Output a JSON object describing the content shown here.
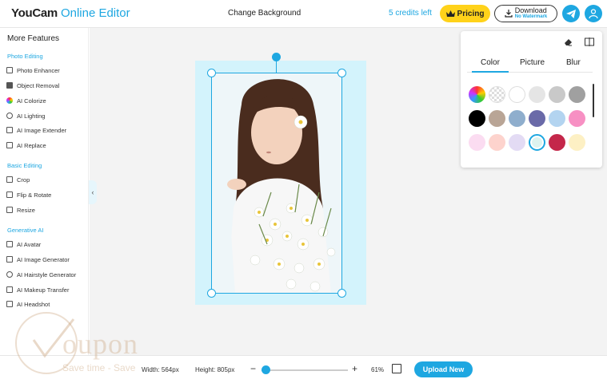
{
  "header": {
    "logo_brand": "YouCam",
    "logo_sub": "Online Editor",
    "page_title": "Change Background",
    "credits": "5 credits left",
    "pricing_label": "Pricing",
    "download_label": "Download",
    "download_sub": "No Watermark"
  },
  "sidebar": {
    "heading": "More Features",
    "sections": [
      {
        "title": "Photo Editing",
        "items": [
          "Photo Enhancer",
          "Object Removal",
          "AI Colorize",
          "AI Lighting",
          "AI Image Extender",
          "AI Replace"
        ]
      },
      {
        "title": "Basic Editing",
        "items": [
          "Crop",
          "Flip & Rotate",
          "Resize"
        ]
      },
      {
        "title": "Generative AI",
        "items": [
          "AI Avatar",
          "AI Image Generator",
          "AI Hairstyle Generator",
          "AI Makeup Transfer",
          "AI Headshot"
        ]
      }
    ]
  },
  "panel": {
    "tabs": [
      "Color",
      "Picture",
      "Blur"
    ],
    "active_tab": "Color",
    "swatches": [
      [
        "picker",
        "transparent",
        "#ffffff",
        "#e5e5e5",
        "#c9c9c9",
        "#a0a0a0"
      ],
      [
        "#000000",
        "#b9a596",
        "#8faecd",
        "#6a6aa8",
        "#b3d4f0",
        "#f790c3"
      ],
      [
        "#fbdcf1",
        "#fdd3cd",
        "#e3dbf4",
        "#ddf3ef",
        "#c4274a",
        "#fdf0c4"
      ]
    ],
    "selected_swatch": "#ddf3ef"
  },
  "watermark": {
    "text": "oupon",
    "tagline": "Save time - Save"
  },
  "footer": {
    "width_label": "Width:",
    "width_value": "564px",
    "height_label": "Height:",
    "height_value": "805px",
    "zoom_minus": "−",
    "zoom_plus": "+",
    "zoom_percent": "61%",
    "zoom_level": 0.05,
    "upload_label": "Upload New"
  },
  "colors": {
    "accent": "#1ea7e1",
    "pricing": "#ffd21a",
    "artboard_bg": "#d3f3fc"
  },
  "icons": [
    "crown-icon",
    "download-icon",
    "telegram-icon",
    "user-icon",
    "eraser-icon",
    "compare-icon",
    "collapse-chevron-icon",
    "fit-screen-icon"
  ]
}
